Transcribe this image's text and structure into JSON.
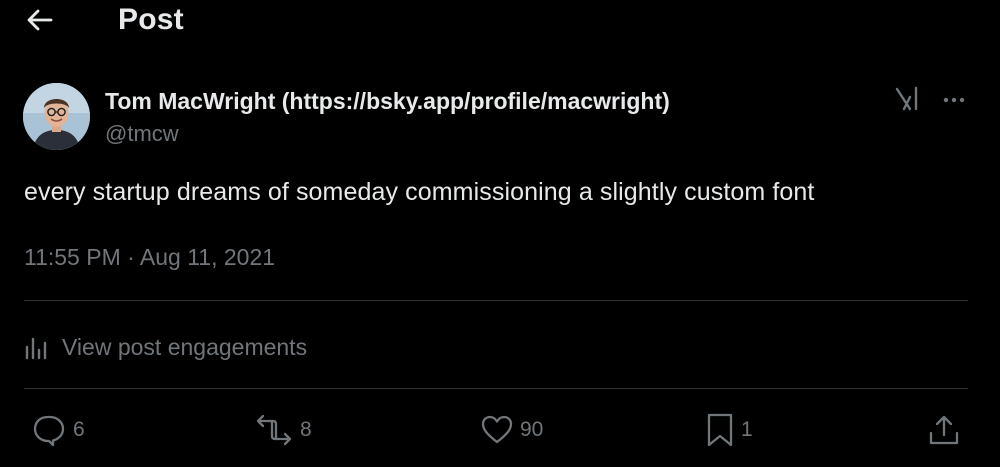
{
  "header": {
    "title": "Post",
    "back_icon": "arrow-left-icon"
  },
  "post": {
    "author_name": "Tom MacWright (https://bsky.app/profile/macwright)",
    "author_handle": "@tmcw",
    "text": "every startup dreams of someday commissioning a slightly custom font",
    "timestamp": "11:55 PM · Aug 11, 2021",
    "engagements_label": "View post engagements"
  },
  "actions": {
    "reply_count": "6",
    "repost_count": "8",
    "like_count": "90",
    "bookmark_count": "1"
  },
  "icons": {
    "grok": "grok-icon",
    "more": "more-icon",
    "engagements": "bar-chart-icon",
    "reply": "reply-icon",
    "repost": "repost-icon",
    "like": "heart-icon",
    "bookmark": "bookmark-icon",
    "share": "share-icon"
  },
  "colors": {
    "background": "#000000",
    "primary_text": "#e7e9ea",
    "secondary_text": "#71767b",
    "divider": "#2f3336"
  }
}
